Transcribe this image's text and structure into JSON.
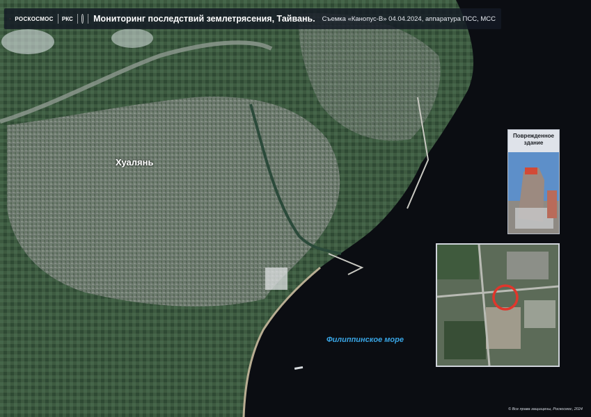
{
  "header": {
    "brand": "РОСКОСМОС",
    "rks": "РКС",
    "title": "Мониторинг последствий землетрясения, Тайвань.",
    "subtitle": "Съемка «Канопус-В» 04.04.2024,  аппаратура ПСС, МСС"
  },
  "map": {
    "city_label": "Хуалянь",
    "sea_label": "Филиппинское море"
  },
  "inset_photo": {
    "caption": "Поврежденное здание"
  },
  "footer": {
    "copyright": "© Все права защищены, Роскосмос, 2024"
  },
  "colors": {
    "sea": "#0b0d12",
    "land": "#3f5440",
    "urban": "#8a8f8a",
    "sea_label": "#39a6e6",
    "highlight_circle": "#e0362c"
  },
  "icons": [
    "roscosmos-logo-icon",
    "rks-logo-icon",
    "emblem-icon"
  ]
}
